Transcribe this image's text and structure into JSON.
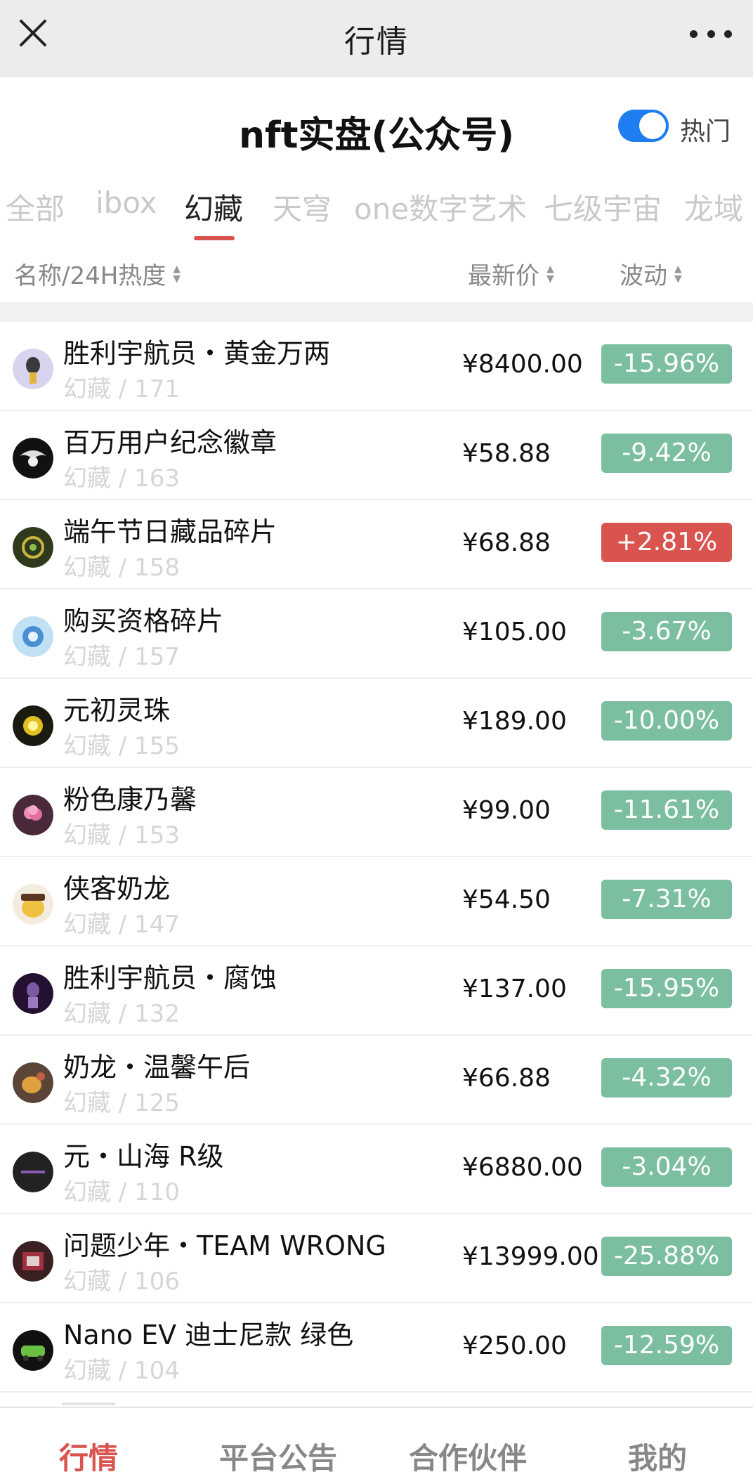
{
  "topbar": {
    "title": "行情"
  },
  "header": {
    "title": "nft实盘(公众号)",
    "toggle_label": "热门",
    "toggle_on": true
  },
  "tabs": [
    "全部",
    "ibox",
    "幻藏",
    "天穹",
    "one数字艺术",
    "七级宇宙",
    "龙域"
  ],
  "columns": {
    "name": "名称/24H热度",
    "price": "最新价",
    "change": "波动"
  },
  "rows": [
    {
      "name": "胜利宇航员・黄金万两",
      "sub": "幻藏 / 171",
      "price": "¥8400.00",
      "change": "-15.96%",
      "dir": "down"
    },
    {
      "name": "百万用户纪念徽章",
      "sub": "幻藏 / 163",
      "price": "¥58.88",
      "change": "-9.42%",
      "dir": "down"
    },
    {
      "name": "端午节日藏品碎片",
      "sub": "幻藏 / 158",
      "price": "¥68.88",
      "change": "+2.81%",
      "dir": "up"
    },
    {
      "name": "购买资格碎片",
      "sub": "幻藏 / 157",
      "price": "¥105.00",
      "change": "-3.67%",
      "dir": "down"
    },
    {
      "name": "元初灵珠",
      "sub": "幻藏 / 155",
      "price": "¥189.00",
      "change": "-10.00%",
      "dir": "down"
    },
    {
      "name": "粉色康乃馨",
      "sub": "幻藏 / 153",
      "price": "¥99.00",
      "change": "-11.61%",
      "dir": "down"
    },
    {
      "name": "侠客奶龙",
      "sub": "幻藏 / 147",
      "price": "¥54.50",
      "change": "-7.31%",
      "dir": "down"
    },
    {
      "name": "胜利宇航员・腐蚀",
      "sub": "幻藏 / 132",
      "price": "¥137.00",
      "change": "-15.95%",
      "dir": "down"
    },
    {
      "name": "奶龙・温馨午后",
      "sub": "幻藏 / 125",
      "price": "¥66.88",
      "change": "-4.32%",
      "dir": "down"
    },
    {
      "name": "元・山海 R级",
      "sub": "幻藏 / 110",
      "price": "¥6880.00",
      "change": "-3.04%",
      "dir": "down"
    },
    {
      "name": "问题少年・TEAM WRONG",
      "sub": "幻藏 / 106",
      "price": "¥13999.00",
      "change": "-25.88%",
      "dir": "down"
    },
    {
      "name": "Nano EV 迪士尼款 绿色",
      "sub": "幻藏 / 104",
      "price": "¥250.00",
      "change": "-12.59%",
      "dir": "down"
    }
  ],
  "bottom_nav": [
    "行情",
    "平台公告",
    "合作伙伴",
    "我的"
  ],
  "colors": {
    "accent": "#d9534f",
    "down": "#7bbfa0",
    "up": "#d9534f",
    "toggle": "#1e7df0"
  }
}
